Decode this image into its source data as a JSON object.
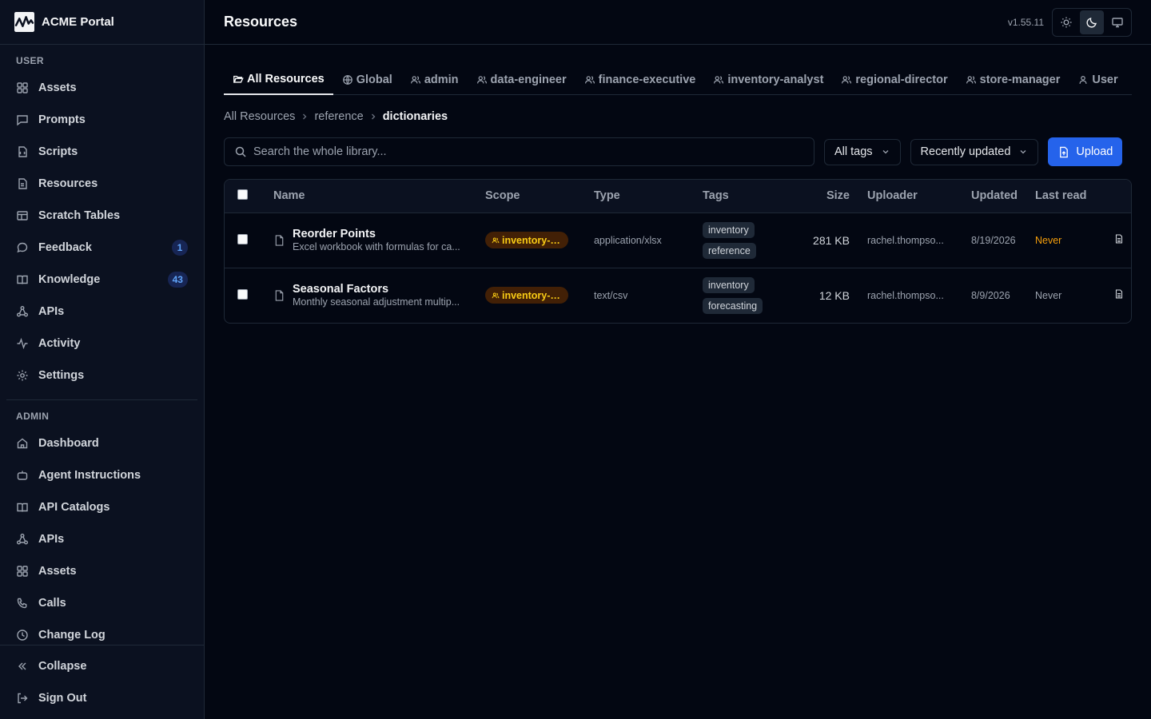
{
  "app": {
    "title": "ACME Portal",
    "version": "v1.55.11"
  },
  "sidebar": {
    "user_label": "USER",
    "user_items": [
      {
        "label": "Assets",
        "icon": "grid-icon"
      },
      {
        "label": "Prompts",
        "icon": "message-icon"
      },
      {
        "label": "Scripts",
        "icon": "script-icon"
      },
      {
        "label": "Resources",
        "icon": "file-icon"
      },
      {
        "label": "Scratch Tables",
        "icon": "table-icon"
      },
      {
        "label": "Feedback",
        "icon": "chat-icon",
        "badge": "1"
      },
      {
        "label": "Knowledge",
        "icon": "book-icon",
        "badge": "43"
      },
      {
        "label": "APIs",
        "icon": "network-icon"
      },
      {
        "label": "Activity",
        "icon": "activity-icon"
      },
      {
        "label": "Settings",
        "icon": "gear-icon"
      }
    ],
    "admin_label": "ADMIN",
    "admin_items": [
      {
        "label": "Dashboard",
        "icon": "home-icon"
      },
      {
        "label": "Agent Instructions",
        "icon": "bot-icon"
      },
      {
        "label": "API Catalogs",
        "icon": "book-icon"
      },
      {
        "label": "APIs",
        "icon": "network-icon"
      },
      {
        "label": "Assets",
        "icon": "grid-icon"
      },
      {
        "label": "Calls",
        "icon": "phone-icon"
      },
      {
        "label": "Change Log",
        "icon": "clock-icon"
      }
    ],
    "collapse_label": "Collapse",
    "signout_label": "Sign Out"
  },
  "header": {
    "title": "Resources"
  },
  "tabs": [
    {
      "label": "All Resources",
      "active": true,
      "icon": "folder-open-icon"
    },
    {
      "label": "Global",
      "icon": "globe-icon"
    },
    {
      "label": "admin",
      "icon": "users-icon"
    },
    {
      "label": "data-engineer",
      "icon": "users-icon"
    },
    {
      "label": "finance-executive",
      "icon": "users-icon"
    },
    {
      "label": "inventory-analyst",
      "icon": "users-icon"
    },
    {
      "label": "regional-director",
      "icon": "users-icon"
    },
    {
      "label": "store-manager",
      "icon": "users-icon"
    },
    {
      "label": "User",
      "icon": "user-icon"
    }
  ],
  "breadcrumb": [
    "All Resources",
    "reference",
    "dictionaries"
  ],
  "toolbar": {
    "search_placeholder": "Search the whole library...",
    "tags_filter": "All tags",
    "sort": "Recently updated",
    "upload_label": "Upload"
  },
  "table": {
    "headers": {
      "name": "Name",
      "scope": "Scope",
      "type": "Type",
      "tags": "Tags",
      "size": "Size",
      "uploader": "Uploader",
      "updated": "Updated",
      "last_read": "Last read"
    },
    "rows": [
      {
        "name": "Reorder Points",
        "description": "Excel workbook with formulas for ca...",
        "scope": "inventory-a...",
        "type": "application/xlsx",
        "tags": [
          "inventory",
          "reference"
        ],
        "size": "281 KB",
        "uploader": "rachel.thompso...",
        "updated": "8/19/2026",
        "last_read": "Never",
        "last_read_color": "#f59e0b"
      },
      {
        "name": "Seasonal Factors",
        "description": "Monthly seasonal adjustment multip...",
        "scope": "inventory-a...",
        "type": "text/csv",
        "tags": [
          "inventory",
          "forecasting"
        ],
        "size": "12 KB",
        "uploader": "rachel.thompso...",
        "updated": "8/9/2026",
        "last_read": "Never",
        "last_read_color": "#9ca3af"
      }
    ]
  },
  "colors": {
    "accent": "#2563eb",
    "background": "#030712",
    "sidebar": "#0b1120",
    "scope_badge": "#facc15"
  }
}
